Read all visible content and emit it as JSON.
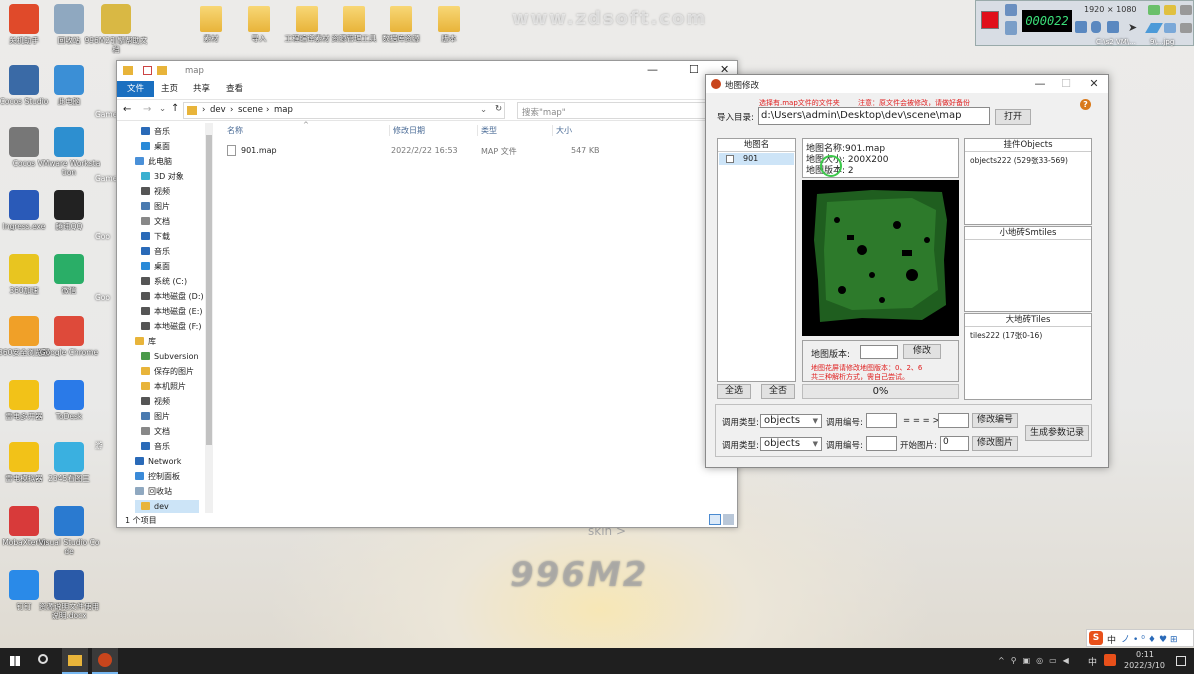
{
  "watermark": {
    "site": "www.zdsoft.com",
    "brand": "996M2",
    "skin": "skin >"
  },
  "desktop": {
    "icons": [
      {
        "label": "关机助手",
        "icon": "power-icon",
        "color": "#e04a2a"
      },
      {
        "label": "回收站",
        "icon": "recycle-bin-icon",
        "color": "#8fa8c0"
      },
      {
        "label": "996M2引擎帮助文档",
        "icon": "help-doc-icon",
        "color": "#d9b844"
      },
      {
        "label": "Cocos Studio",
        "icon": "cocos-studio-icon",
        "color": "#3a6aa6"
      },
      {
        "label": "此电脑",
        "icon": "computer-icon",
        "color": "#3b8fd6"
      },
      {
        "label": "Cocos",
        "icon": "cocos-icon",
        "color": "#777"
      },
      {
        "label": "VMware Workstation",
        "icon": "vmware-icon",
        "color": "#2d8fd0"
      },
      {
        "label": "Ingress.exe",
        "icon": "shield-app-icon",
        "color": "#2a5ab8"
      },
      {
        "label": "腾讯QQ",
        "icon": "qq-icon",
        "color": "#222"
      },
      {
        "label": "360加速",
        "icon": "speed-icon",
        "color": "#e8c520"
      },
      {
        "label": "微信",
        "icon": "wechat-icon",
        "color": "#2aae67"
      },
      {
        "label": "360安全浏览器",
        "icon": "browser-360-icon",
        "color": "#f0a028"
      },
      {
        "label": "Google Chrome",
        "icon": "chrome-icon",
        "color": "#de4a3a"
      },
      {
        "label": "雷电多开器",
        "icon": "leidian-icon",
        "color": "#f2c218"
      },
      {
        "label": "ToDesk",
        "icon": "todesk-icon",
        "color": "#2a7ae8"
      },
      {
        "label": "雷电模拟器",
        "icon": "emulator-icon",
        "color": "#f2c218"
      },
      {
        "label": "2345看图王",
        "icon": "image-viewer-icon",
        "color": "#3ab0e0"
      },
      {
        "label": "MobaXterm",
        "icon": "mobaxterm-icon",
        "color": "#d83a3a"
      },
      {
        "label": "Visual Studio Code",
        "icon": "vscode-icon",
        "color": "#2a7ad0"
      },
      {
        "label": "钉钉",
        "icon": "dingtalk-icon",
        "color": "#2a8ae8"
      },
      {
        "label": "资源说明文件使用说明.docx",
        "icon": "word-doc-icon",
        "color": "#2a5aa8"
      }
    ],
    "folders": [
      "素材",
      "导入",
      "工程编译素材",
      "资源管理工具",
      "数据库资源",
      "版本"
    ],
    "partials": [
      "Game",
      "Game",
      "Goo",
      "Goo",
      "游"
    ]
  },
  "recorder": {
    "time": "000022",
    "resolution": "1920 × 1080",
    "labels": [
      "C:\\s2 VM\\...",
      "9\\...jpg"
    ]
  },
  "explorer": {
    "title": "map",
    "ribbon_tabs": [
      "文件",
      "主页",
      "共享",
      "查看"
    ],
    "path": [
      "dev",
      "scene",
      "map"
    ],
    "search_placeholder": "搜索\"map\"",
    "columns": [
      "名称",
      "修改日期",
      "类型",
      "大小"
    ],
    "files": [
      {
        "name": "901.map",
        "date": "2022/2/22 16:53",
        "type": "MAP 文件",
        "size": "547 KB"
      }
    ],
    "sidebar": [
      "音乐",
      "桌面",
      "此电脑",
      "3D 对象",
      "视频",
      "图片",
      "文档",
      "下载",
      "音乐",
      "桌面",
      "系统 (C:)",
      "本地磁盘 (D:)",
      "本地磁盘 (E:)",
      "本地磁盘 (F:)",
      "库",
      "Subversion",
      "保存的图片",
      "本机照片",
      "视频",
      "图片",
      "文档",
      "音乐",
      "Network",
      "控制面板",
      "回收站",
      "dev"
    ],
    "status": "1 个项目"
  },
  "editor": {
    "title": "地图修改",
    "hint1": "选择有.map文件的文件夹",
    "hint2": "注意：原文件会被修改，请做好备份",
    "import_label": "导入目录:",
    "import_path": "d:\\Users\\admin\\Desktop\\dev\\scene\\map",
    "open_btn": "打开",
    "list_header": "地图名",
    "list_items": [
      "901"
    ],
    "info_name": "地图名称:901.map",
    "info_size": "地图大小: 200X200",
    "info_version": "地图版本: 2",
    "version_label": "地图版本:",
    "version_value": "",
    "modify_btn": "修改",
    "red_note1": "地图花屏请修改地图版本：0、2、6",
    "red_note2": "共三种解析方式，需自己尝试。",
    "progress": "0%",
    "progress_value": 0,
    "select_all": "全选",
    "select_none": "全否",
    "objects_header": "挂件Objects",
    "objects_item": "objects222 (529张33-569)",
    "smtiles_header": "小地砖Smtiles",
    "tiles_header": "大地砖Tiles",
    "tiles_item": "tiles222 (17张0-16)",
    "row1": {
      "type_label": "调用类型:",
      "type_value": "objects",
      "num_label": "调用编号:",
      "num_value": "",
      "arrow": "= = = >",
      "target_value": "",
      "btn": "修改编号"
    },
    "row2": {
      "type_label": "调用类型:",
      "type_value": "objects",
      "num_label": "调用编号:",
      "num_value": "",
      "start_label": "开始图片:",
      "start_value": "0",
      "btn": "修改图片"
    },
    "gen_btn": "生成参数记录"
  },
  "taskbar": {
    "clock_time": "0:11",
    "clock_date": "2022/3/10",
    "ime": "中"
  }
}
